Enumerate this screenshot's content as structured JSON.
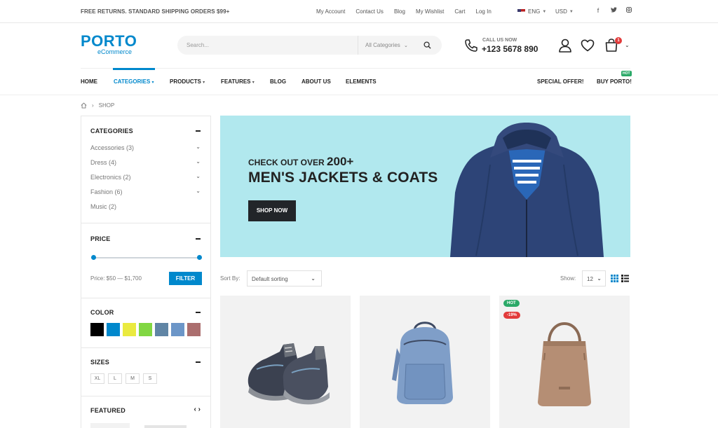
{
  "topbar": {
    "promo": "FREE RETURNS. STANDARD SHIPPING ORDERS $99+",
    "links": [
      "My Account",
      "Contact Us",
      "Blog",
      "My Wishlist",
      "Cart",
      "Log In"
    ],
    "language": "ENG",
    "currency": "USD",
    "socials": [
      "facebook-icon",
      "twitter-icon",
      "instagram-icon"
    ]
  },
  "header": {
    "logo_main": "PORTO",
    "logo_sub": "eCommerce",
    "search_placeholder": "Search...",
    "search_category": "All Categories",
    "call_label": "CALL US NOW",
    "phone": "+123 5678 890",
    "cart_count": "1",
    "icons": [
      "user-icon",
      "heart-icon",
      "cart-icon"
    ]
  },
  "nav": {
    "items": [
      "HOME",
      "CATEGORIES",
      "PRODUCTS",
      "FEATURES",
      "BLOG",
      "ABOUT US",
      "ELEMENTS"
    ],
    "active": "CATEGORIES",
    "special": "SPECIAL OFFER!",
    "buy": "BUY PORTO!",
    "hot": "HOT"
  },
  "breadcrumb": {
    "current": "SHOP"
  },
  "sidebar": {
    "categories_title": "CATEGORIES",
    "categories": [
      "Accessories (3)",
      "Dress (4)",
      "Electronics (2)",
      "Fashion (6)",
      "Music (2)"
    ],
    "price_title": "PRICE",
    "price_range": "Price: $50 — $1,700",
    "price_min": 50,
    "price_max": 1700,
    "filter_label": "FILTER",
    "color_title": "COLOR",
    "colors": [
      "#000000",
      "#0188cc",
      "#eaea3f",
      "#81d742",
      "#6085a5",
      "#6c96c8",
      "#ab6e6e"
    ],
    "sizes_title": "SIZES",
    "sizes": [
      "XL",
      "L",
      "M",
      "S"
    ],
    "featured_title": "FEATURED",
    "featured_arrows": "‹ ›"
  },
  "banner": {
    "line1": "CHECK OUT OVER",
    "line1_num": "200+",
    "line2": "MEN'S JACKETS & COATS",
    "button": "SHOP NOW",
    "bg": "#b1e8ee"
  },
  "toolbar": {
    "sort_label": "Sort By:",
    "sort_value": "Default sorting",
    "show_label": "Show:",
    "show_value": "12"
  },
  "products": [
    {
      "image": "sneakers",
      "badges": []
    },
    {
      "image": "backpack",
      "badges": []
    },
    {
      "image": "handbag",
      "badges": [
        {
          "text": "HOT",
          "color": "#2ba968"
        },
        {
          "text": "-19%",
          "color": "#e23b3b"
        }
      ]
    }
  ]
}
